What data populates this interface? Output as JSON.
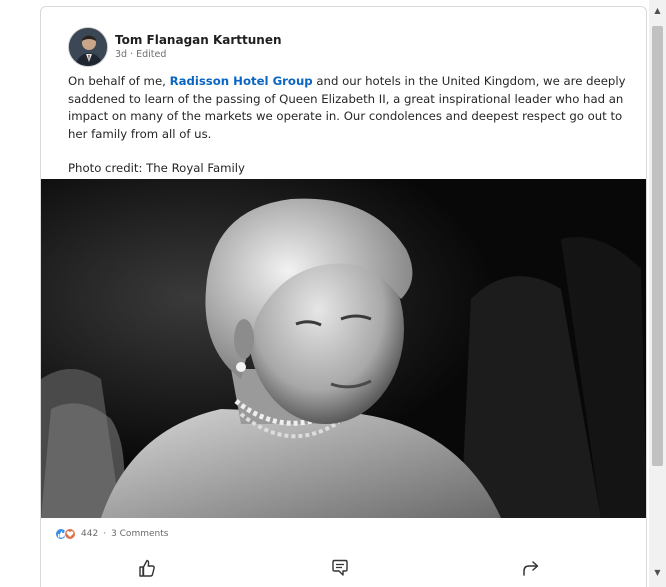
{
  "post": {
    "author": "Tom Flanagan Karttunen",
    "meta": "3d · Edited",
    "text_before": "On behalf of me, ",
    "mention": "Radisson Hotel Group",
    "text_after": " and our hotels in the United Kingdom, we are deeply saddened to learn of the passing of Queen Elizabeth II, a great inspirational leader who had an impact on many of the markets we operate in. Our condolences and deepest respect go out to her family from all of us.",
    "credit": "Photo credit: The Royal Family"
  },
  "social": {
    "reactions": "442",
    "separator": "·",
    "comments": "3 Comments"
  },
  "icons": {
    "like_reaction": "like-icon",
    "love_reaction": "heart-icon",
    "like_action": "thumbs-up-icon",
    "comment_action": "comment-icon",
    "share_action": "share-arrow-icon"
  },
  "colors": {
    "accent_link": "#0a66c2",
    "like_blue": "#378fe9",
    "love_red": "#df704d"
  }
}
